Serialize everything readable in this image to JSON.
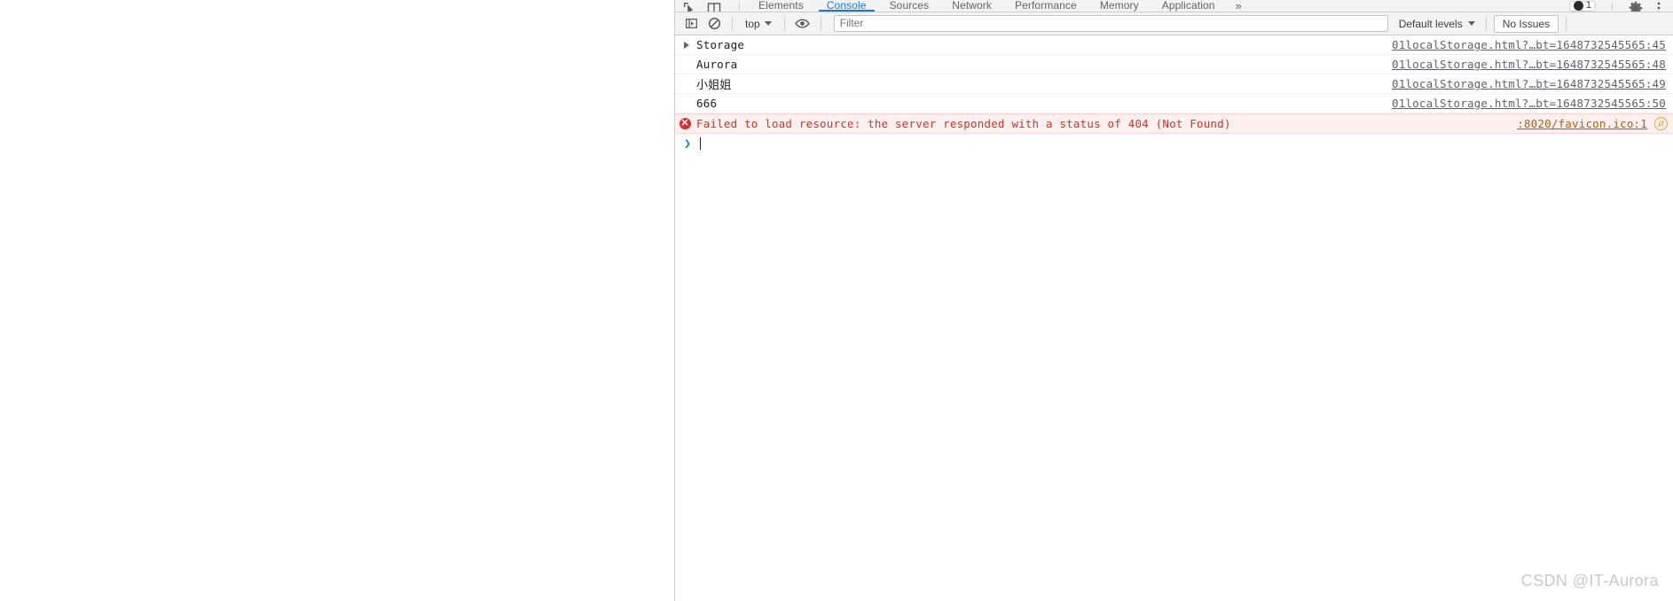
{
  "devtools": {
    "tabstrip": {
      "icons": [
        {
          "name": "inspect-element-icon",
          "glyph": "inspect"
        },
        {
          "name": "device-toolbar-icon",
          "glyph": "device"
        }
      ],
      "tabs": [
        {
          "label": "Elements",
          "active": false
        },
        {
          "label": "Console",
          "active": true
        },
        {
          "label": "Sources",
          "active": false
        },
        {
          "label": "Network",
          "active": false
        },
        {
          "label": "Performance",
          "active": false
        },
        {
          "label": "Memory",
          "active": false
        },
        {
          "label": "Application",
          "active": false
        }
      ],
      "more_label": "»",
      "error_badge_count": "1",
      "settings_icon": "gear-icon",
      "menu_icon": "kebab-menu-icon"
    },
    "toolbar": {
      "sidebar_toggle_icon": "show-console-sidebar-icon",
      "clear_icon": "clear-console-icon",
      "context_label": "top",
      "eye_icon": "live-expression-icon",
      "filter_placeholder": "Filter",
      "filter_value": "",
      "levels_label": "Default levels",
      "issues_label": "No Issues"
    },
    "messages": [
      {
        "kind": "log",
        "expandable": true,
        "text": "Storage",
        "cjk": false,
        "link": "01localStorage.html?…bt=1648732545565:45"
      },
      {
        "kind": "log",
        "expandable": false,
        "text": "Aurora",
        "cjk": false,
        "link": "01localStorage.html?…bt=1648732545565:48"
      },
      {
        "kind": "log",
        "expandable": false,
        "text": "小姐姐",
        "cjk": true,
        "link": "01localStorage.html?…bt=1648732545565:49"
      },
      {
        "kind": "log",
        "expandable": false,
        "text": "666",
        "cjk": false,
        "link": "01localStorage.html?…bt=1648732545565:50"
      },
      {
        "kind": "error",
        "expandable": false,
        "text": "Failed to load resource: the server responded with a status of 404 (Not Found)",
        "cjk": false,
        "link": ":8020/favicon.ico:1",
        "trailing_icon": "network-request-blocked-icon"
      }
    ],
    "prompt": {
      "arrow": "❯",
      "value": ""
    }
  },
  "watermark": {
    "text": "CSDN @IT-Aurora"
  },
  "colors": {
    "accent": "#1a73e8",
    "error": "#d93025",
    "error_bg": "#fff0f0",
    "link": "#5f6368",
    "toolbar_bg": "#f3f3f3",
    "border": "#cdcdcd",
    "watermark": "#c9c9c9"
  }
}
